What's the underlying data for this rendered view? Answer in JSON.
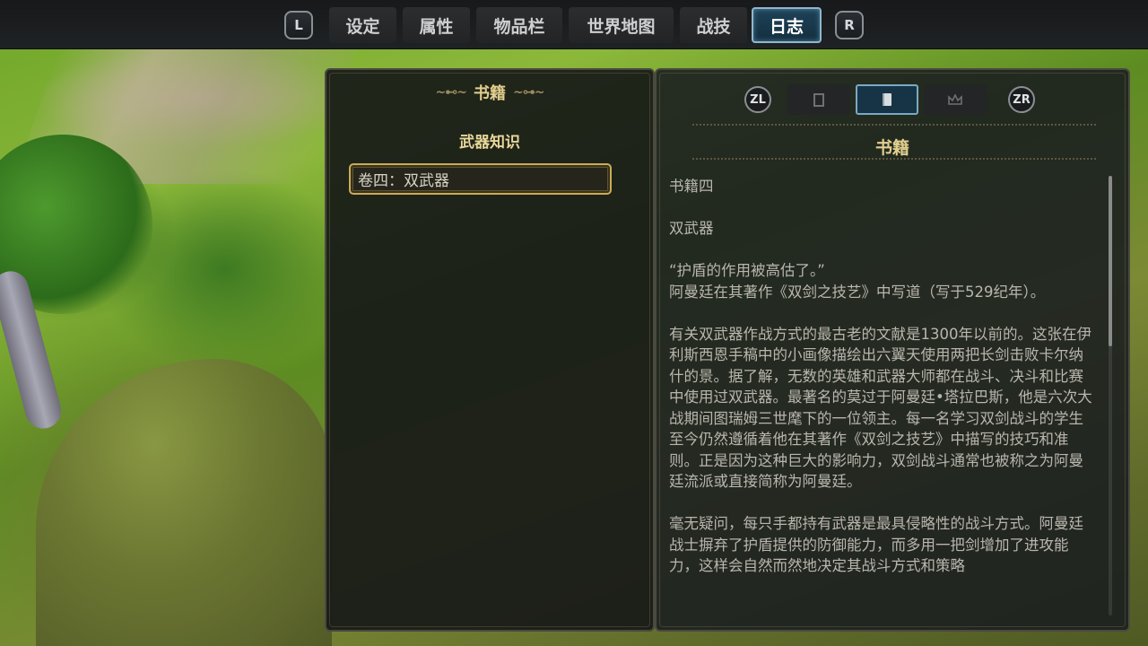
{
  "topbar": {
    "left_shoulder": "L",
    "right_shoulder": "R",
    "tabs": [
      {
        "label": "设定"
      },
      {
        "label": "属性"
      },
      {
        "label": "物品栏"
      },
      {
        "label": "世界地图"
      },
      {
        "label": "战技"
      },
      {
        "label": "日志",
        "active": true
      }
    ]
  },
  "left_panel": {
    "title": "书籍",
    "category": "武器知识",
    "entries": [
      {
        "label": "卷四：双武器",
        "selected": true
      }
    ]
  },
  "right_panel": {
    "left_trigger": "ZL",
    "right_trigger": "ZR",
    "icon_tabs": [
      {
        "icon": "scroll-icon"
      },
      {
        "icon": "book-icon",
        "active": true
      },
      {
        "icon": "crown-icon"
      }
    ],
    "title": "书籍",
    "paragraphs": [
      "书籍四",
      "双武器",
      "“护盾的作用被高估了。”\n阿曼廷在其著作《双剑之技艺》中写道（写于529纪年）。",
      "有关双武器作战方式的最古老的文献是1300年以前的。这张在伊利斯西恩手稿中的小画像描绘出六翼天使用两把长剑击败卡尔纳什的景。据了解，无数的英雄和武器大师都在战斗、决斗和比赛中使用过双武器。最著名的莫过于阿曼廷•塔拉巴斯，他是六次大战期间图瑞姆三世麾下的一位领主。每一名学习双剑战斗的学生至今仍然遵循着他在其著作《双剑之技艺》中描写的技巧和准则。正是因为这种巨大的影响力，双剑战斗通常也被称之为阿曼廷流派或直接简称为阿曼廷。",
      "毫无疑问，每只手都持有武器是最具侵略性的战斗方式。阿曼廷战士摒弃了护盾提供的防御能力，而多用一把剑增加了进攻能力，这样会自然而然地决定其战斗方式和策略"
    ],
    "scroll_position": 0.0
  }
}
